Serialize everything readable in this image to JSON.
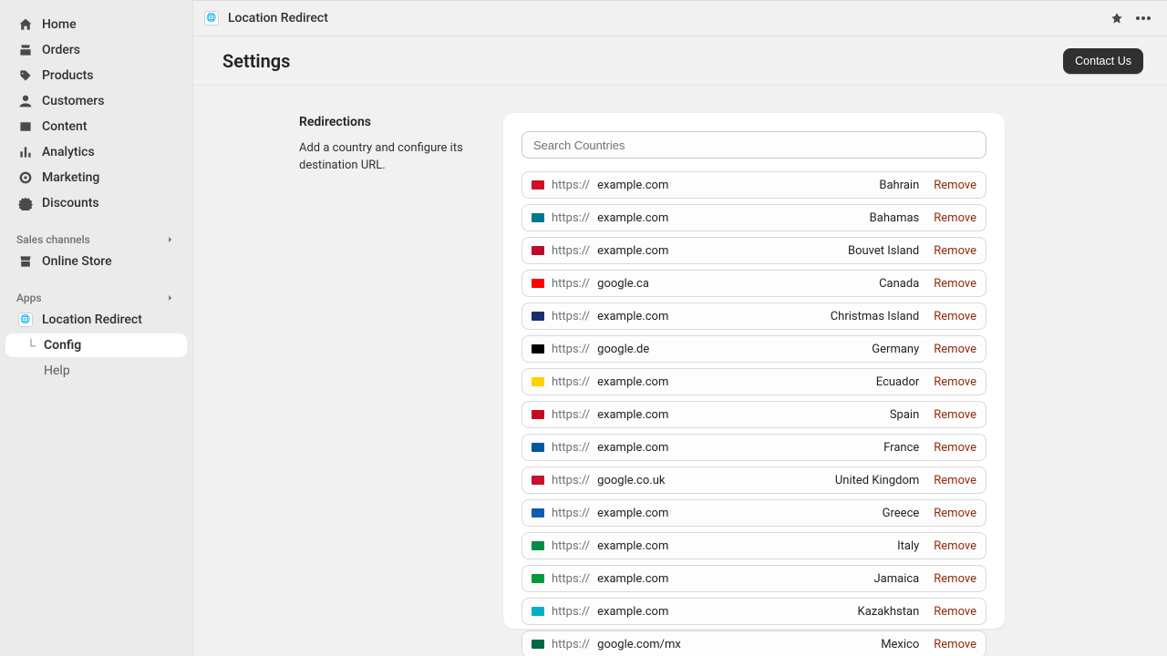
{
  "sidebar": {
    "nav": [
      {
        "label": "Home"
      },
      {
        "label": "Orders"
      },
      {
        "label": "Products"
      },
      {
        "label": "Customers"
      },
      {
        "label": "Content"
      },
      {
        "label": "Analytics"
      },
      {
        "label": "Marketing"
      },
      {
        "label": "Discounts"
      }
    ],
    "sales_header": "Sales channels",
    "online_store": "Online Store",
    "apps_header": "Apps",
    "app_items": [
      {
        "label": "Location Redirect"
      },
      {
        "label": "Config"
      },
      {
        "label": "Help"
      }
    ]
  },
  "topbar": {
    "title": "Location Redirect"
  },
  "header": {
    "title": "Settings",
    "contact": "Contact Us"
  },
  "section": {
    "title": "Redirections",
    "desc": "Add a country and configure its destination URL."
  },
  "search": {
    "placeholder": "Search Countries"
  },
  "url_prefix": "https://",
  "remove_label": "Remove",
  "redirections": [
    {
      "domain": "example.com",
      "country": "Bahrain",
      "flag": "#ce1126"
    },
    {
      "domain": "example.com",
      "country": "Bahamas",
      "flag": "#00778b"
    },
    {
      "domain": "example.com",
      "country": "Bouvet Island",
      "flag": "#ba0c2f"
    },
    {
      "domain": "google.ca",
      "country": "Canada",
      "flag": "#ff0000"
    },
    {
      "domain": "example.com",
      "country": "Christmas Island",
      "flag": "#1b2f6b"
    },
    {
      "domain": "google.de",
      "country": "Germany",
      "flag": "#000000"
    },
    {
      "domain": "example.com",
      "country": "Ecuador",
      "flag": "#ffd100"
    },
    {
      "domain": "example.com",
      "country": "Spain",
      "flag": "#c60b1e"
    },
    {
      "domain": "example.com",
      "country": "France",
      "flag": "#0055a4"
    },
    {
      "domain": "google.co.uk",
      "country": "United Kingdom",
      "flag": "#c8102e"
    },
    {
      "domain": "example.com",
      "country": "Greece",
      "flag": "#0d5eaf"
    },
    {
      "domain": "example.com",
      "country": "Italy",
      "flag": "#008c45"
    },
    {
      "domain": "example.com",
      "country": "Jamaica",
      "flag": "#009b3a"
    },
    {
      "domain": "example.com",
      "country": "Kazakhstan",
      "flag": "#00afca"
    },
    {
      "domain": "google.com/mx",
      "country": "Mexico",
      "flag": "#006847"
    }
  ]
}
